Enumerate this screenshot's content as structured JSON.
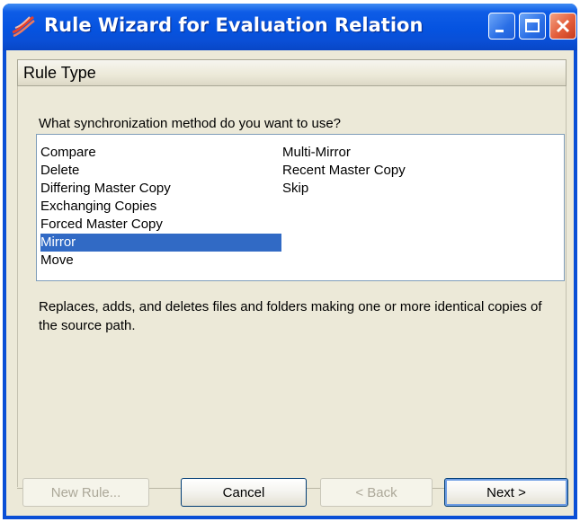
{
  "window": {
    "title": "Rule Wizard for Evaluation Relation"
  },
  "titlebar_buttons": {
    "minimize_icon": "minimize-icon",
    "maximize_icon": "maximize-icon",
    "close_icon": "close-icon"
  },
  "header": {
    "title": "Rule Type"
  },
  "question": "What synchronization method do you want to use?",
  "methods": {
    "column1": [
      "Compare",
      "Delete",
      "Differing Master Copy",
      "Exchanging Copies",
      "Forced Master Copy",
      "Mirror",
      "Move"
    ],
    "column2": [
      "Multi-Mirror",
      "Recent Master Copy",
      "Skip"
    ],
    "selected": "Mirror"
  },
  "description": "Replaces, adds, and deletes files and folders making one or more identical copies of the source path.",
  "buttons": {
    "new_rule": "New Rule...",
    "cancel": "Cancel",
    "back": "< Back",
    "next": "Next >"
  },
  "colors": {
    "titlebar": "#0a4fd6",
    "selection": "#316ac5",
    "client": "#ece9d8",
    "close_button": "#e35d3a"
  }
}
